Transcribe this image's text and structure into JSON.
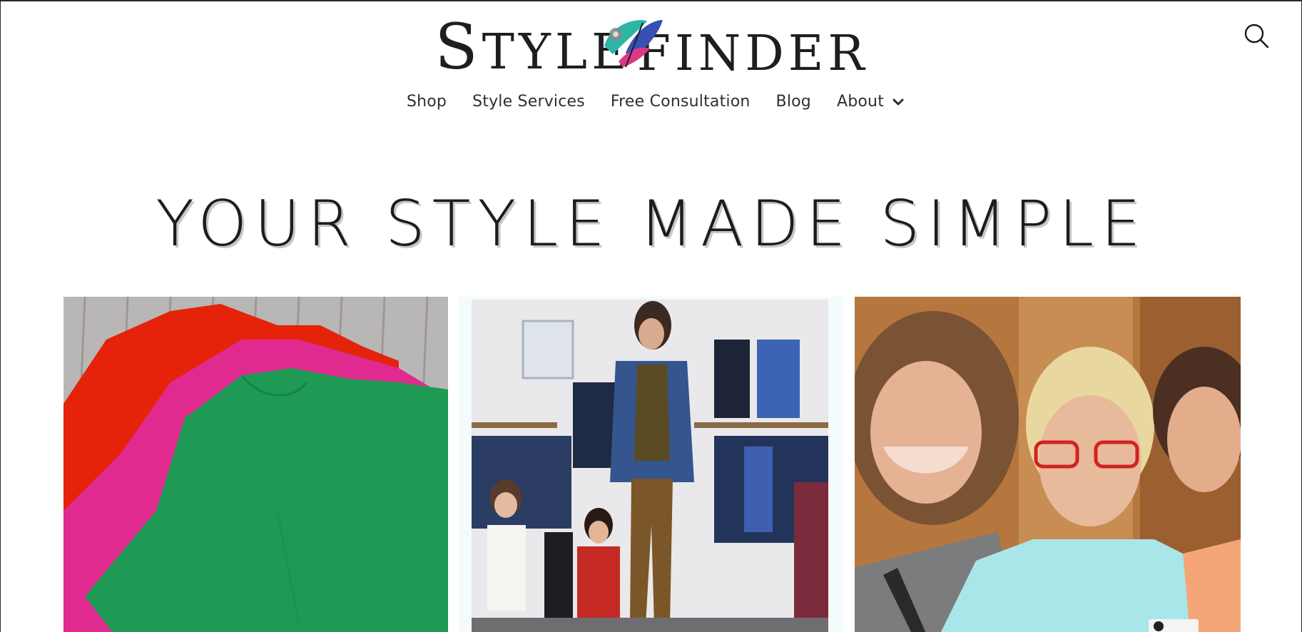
{
  "brand": {
    "logo_text_left": "STYLE",
    "logo_text_right": "FINDER",
    "colors": {
      "teal": "#2bb6a6",
      "blue": "#3a4fb5",
      "magenta": "#d83a86",
      "ink": "#1e1e1e"
    }
  },
  "header": {
    "search_icon": "search-icon"
  },
  "nav": {
    "items": [
      {
        "label": "Shop"
      },
      {
        "label": "Style Services"
      },
      {
        "label": "Free Consultation"
      },
      {
        "label": "Blog"
      },
      {
        "label": "About",
        "has_dropdown": true,
        "dropdown_icon": "chevron-down-icon"
      }
    ]
  },
  "hero": {
    "title": "YOUR STYLE MADE SIMPLE"
  },
  "tiles": [
    {
      "image": "folded colorful blouses photo"
    },
    {
      "image": "fashion show model photo"
    },
    {
      "image": "smiling women group photo"
    }
  ]
}
